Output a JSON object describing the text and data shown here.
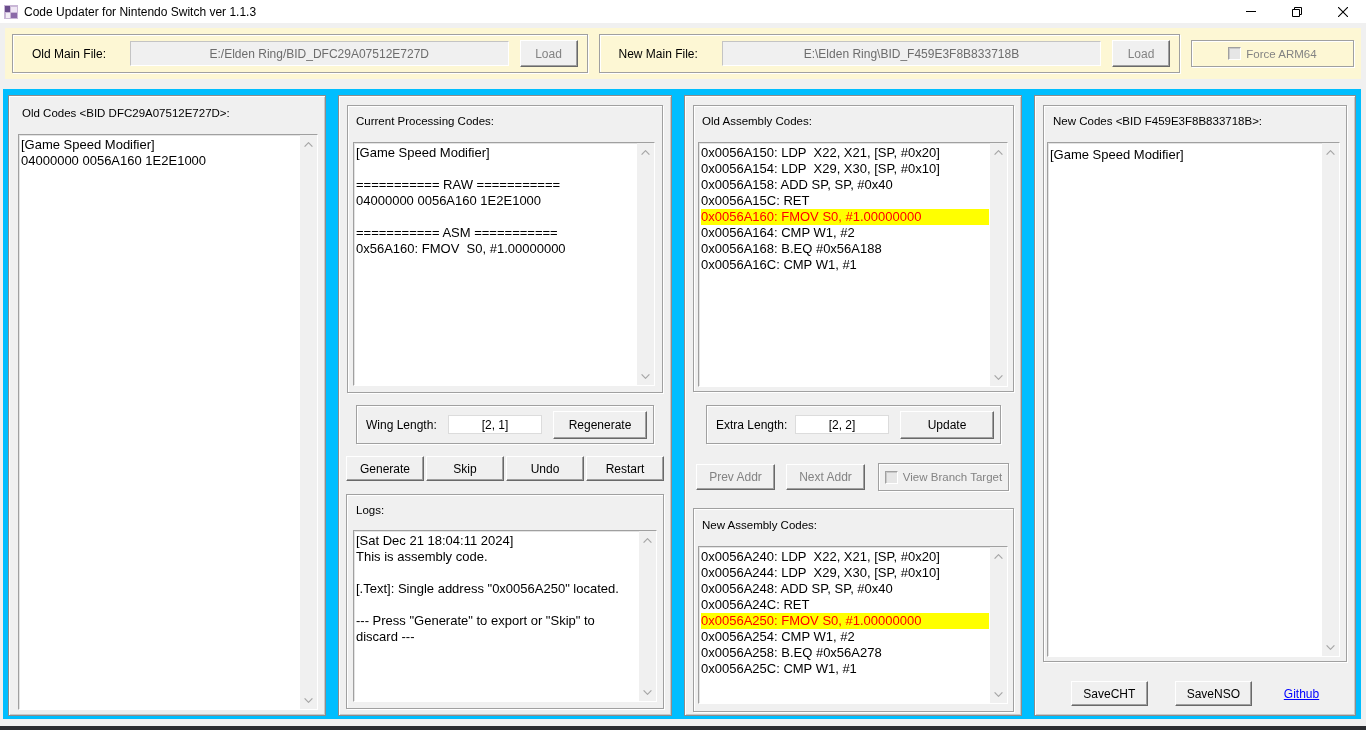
{
  "window": {
    "title": "Code Updater for Nintendo Switch ver 1.1.3"
  },
  "file_bar": {
    "old_main_file": {
      "label": "Old Main File:",
      "path": {
        "value": "E:/Elden Ring/BID_DFC29A07512E727D",
        "disabled": true
      },
      "load_button": {
        "label": "Load",
        "disabled": true
      }
    },
    "new_main_file": {
      "label": "New Main File:",
      "path": {
        "value": "E:\\Elden Ring\\BID_F459E3F8B833718B",
        "disabled": true
      },
      "load_button": {
        "label": "Load",
        "disabled": true
      }
    },
    "force_arm64": {
      "label": "Force ARM64",
      "checked": false,
      "disabled": true
    }
  },
  "old_codes": {
    "title": "Old Codes <BID DFC29A07512E727D>:",
    "text": "[Game Speed Modifier]\n04000000 0056A160 1E2E1000"
  },
  "current_processing": {
    "title": "Current Processing Codes:",
    "text": "[Game Speed Modifier]\n\n=========== RAW ===========\n04000000 0056A160 1E2E1000\n\n=========== ASM ===========\n0x56A160: FMOV  S0, #1.00000000"
  },
  "wing_length": {
    "label": "Wing Length:",
    "value": "[2, 1]",
    "button": {
      "label": "Regenerate",
      "disabled": false
    }
  },
  "actions": [
    {
      "label": "Generate",
      "disabled": false
    },
    {
      "label": "Skip",
      "disabled": false
    },
    {
      "label": "Undo",
      "disabled": false
    },
    {
      "label": "Restart",
      "disabled": false
    }
  ],
  "logs": {
    "title": "Logs:",
    "text": "[Sat Dec 21 18:04:11 2024]\nThis is assembly code.\n\n[.Text]: Single address \"0x0056A250\" located.\n\n--- Press \"Generate\" to export or \"Skip\" to discard ---"
  },
  "old_assembly": {
    "title": "Old Assembly Codes:",
    "lines": [
      {
        "text": "0x0056A150: LDP  X22, X21, [SP, #0x20]",
        "selected": false
      },
      {
        "text": "0x0056A154: LDP  X29, X30, [SP, #0x10]",
        "selected": false
      },
      {
        "text": "0x0056A158: ADD SP, SP, #0x40",
        "selected": false
      },
      {
        "text": "0x0056A15C: RET",
        "selected": false
      },
      {
        "text": "0x0056A160: FMOV S0, #1.00000000",
        "selected": true
      },
      {
        "text": "0x0056A164: CMP W1, #2",
        "selected": false
      },
      {
        "text": "0x0056A168: B.EQ #0x56A188",
        "selected": false
      },
      {
        "text": "0x0056A16C: CMP W1, #1",
        "selected": false
      }
    ]
  },
  "extra_length": {
    "label": "Extra Length:",
    "value": "[2, 2]",
    "button": {
      "label": "Update",
      "disabled": false
    }
  },
  "navigation": {
    "buttons": [
      {
        "label": "Prev Addr",
        "disabled": true
      },
      {
        "label": "Next Addr",
        "disabled": true
      }
    ],
    "view_branch_target": {
      "label": "View Branch Target",
      "checked": false,
      "disabled": true
    }
  },
  "new_assembly": {
    "title": "New Assembly Codes:",
    "lines": [
      {
        "text": "0x0056A240: LDP  X22, X21, [SP, #0x20]",
        "selected": false
      },
      {
        "text": "0x0056A244: LDP  X29, X30, [SP, #0x10]",
        "selected": false
      },
      {
        "text": "0x0056A248: ADD SP, SP, #0x40",
        "selected": false
      },
      {
        "text": "0x0056A24C: RET",
        "selected": false
      },
      {
        "text": "0x0056A250: FMOV S0, #1.00000000",
        "selected": true
      },
      {
        "text": "0x0056A254: CMP W1, #2",
        "selected": false
      },
      {
        "text": "0x0056A258: B.EQ #0x56A278",
        "selected": false
      },
      {
        "text": "0x0056A25C: CMP W1, #1",
        "selected": false
      }
    ]
  },
  "new_codes": {
    "title": "New Codes <BID F459E3F8B833718B>:",
    "text": "[Game Speed Modifier]"
  },
  "save_buttons": [
    {
      "label": "SaveCHT",
      "disabled": false
    },
    {
      "label": "SaveNSO",
      "disabled": false
    }
  ],
  "github_link": {
    "label": "Github"
  }
}
